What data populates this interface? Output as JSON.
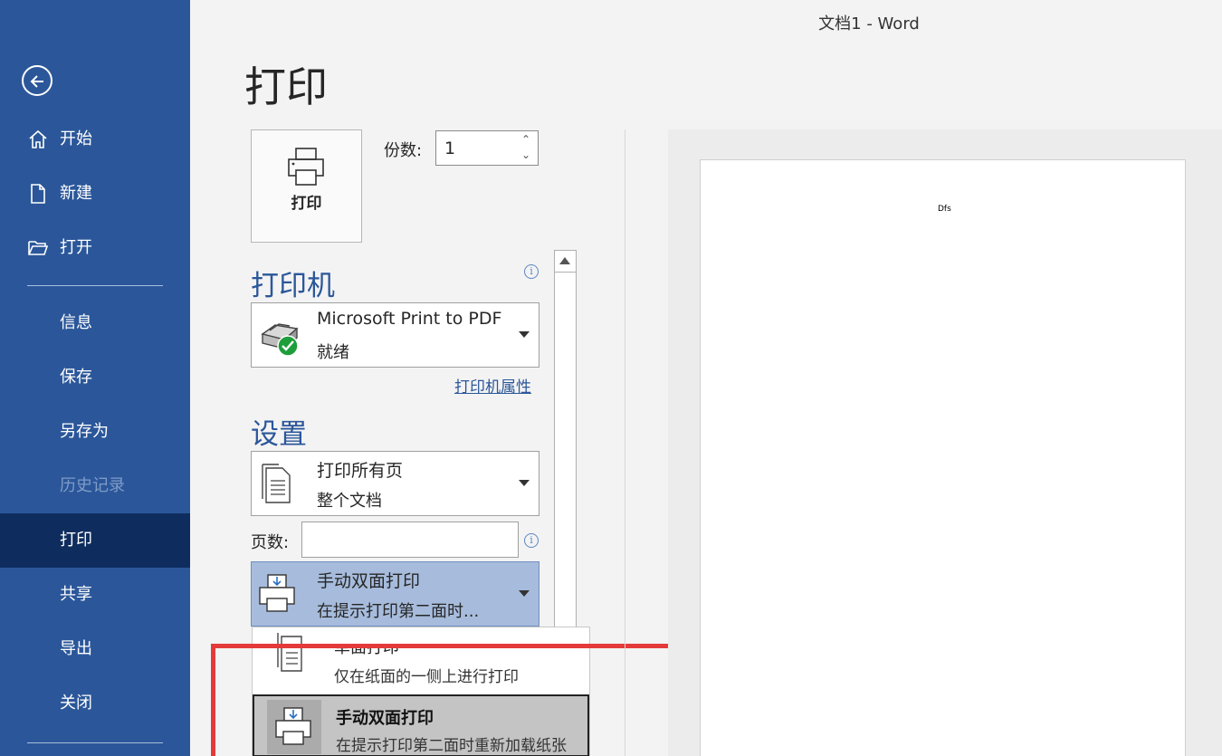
{
  "window": {
    "title": "文档1  -  Word"
  },
  "sidebar": {
    "items": [
      {
        "label": "开始",
        "icon": "home-icon"
      },
      {
        "label": "新建",
        "icon": "new-doc-icon"
      },
      {
        "label": "打开",
        "icon": "folder-open-icon"
      },
      {
        "label": "信息"
      },
      {
        "label": "保存"
      },
      {
        "label": "另存为"
      },
      {
        "label": "历史记录",
        "disabled": true
      },
      {
        "label": "打印",
        "active": true
      },
      {
        "label": "共享"
      },
      {
        "label": "导出"
      },
      {
        "label": "关闭"
      }
    ]
  },
  "print": {
    "page_title": "打印",
    "print_button_label": "打印",
    "copies_label": "份数:",
    "copies_value": "1"
  },
  "printer": {
    "section_title": "打印机",
    "name": "Microsoft Print to PDF",
    "status": "就绪",
    "properties_link": "打印机属性"
  },
  "settings": {
    "section_title": "设置",
    "range_title": "打印所有页",
    "range_sub": "整个文档",
    "pages_label": "页数:",
    "pages_value": "",
    "duplex_title": "手动双面打印",
    "duplex_sub": "在提示打印第二面时..."
  },
  "duplex_menu": {
    "options": [
      {
        "title": "单面打印",
        "sub": "仅在纸面的一侧上进行打印"
      },
      {
        "title": "手动双面打印",
        "sub": "在提示打印第二面时重新加载纸张",
        "highlighted": true
      }
    ]
  },
  "preview": {
    "text": "Dfs"
  },
  "colors": {
    "sidebar": "#2b579a",
    "active": "#0e2d5e",
    "highlight_box": "#e53a3a"
  }
}
